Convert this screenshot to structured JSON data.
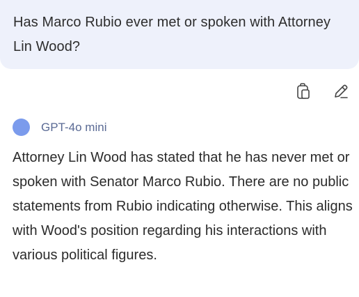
{
  "user_message": {
    "text": "Has Marco Rubio ever met or spoken with Attorney Lin Wood?"
  },
  "actions": {
    "copy_icon": "copy-icon",
    "edit_icon": "pencil-icon"
  },
  "response": {
    "model_name": "GPT-4o mini",
    "model_color": "#7b9bec",
    "text": "Attorney Lin Wood has stated that he has never met or spoken with Senator Marco Rubio. There are no public statements from Rubio indicating otherwise. This aligns with Wood's position regarding his interactions with various political figures."
  }
}
